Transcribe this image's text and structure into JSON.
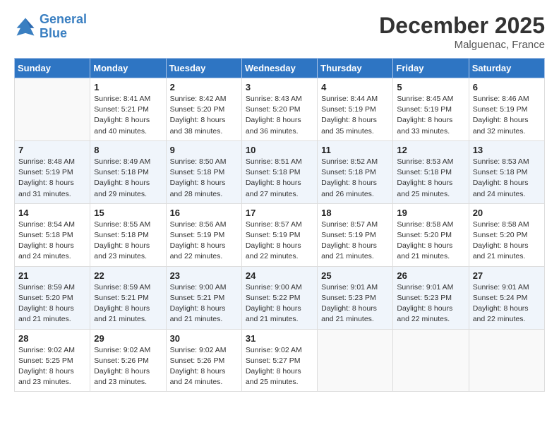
{
  "logo": {
    "line1": "General",
    "line2": "Blue"
  },
  "title": "December 2025",
  "location": "Malguenac, France",
  "days_header": [
    "Sunday",
    "Monday",
    "Tuesday",
    "Wednesday",
    "Thursday",
    "Friday",
    "Saturday"
  ],
  "weeks": [
    [
      {
        "num": "",
        "info": ""
      },
      {
        "num": "1",
        "info": "Sunrise: 8:41 AM\nSunset: 5:21 PM\nDaylight: 8 hours\nand 40 minutes."
      },
      {
        "num": "2",
        "info": "Sunrise: 8:42 AM\nSunset: 5:20 PM\nDaylight: 8 hours\nand 38 minutes."
      },
      {
        "num": "3",
        "info": "Sunrise: 8:43 AM\nSunset: 5:20 PM\nDaylight: 8 hours\nand 36 minutes."
      },
      {
        "num": "4",
        "info": "Sunrise: 8:44 AM\nSunset: 5:19 PM\nDaylight: 8 hours\nand 35 minutes."
      },
      {
        "num": "5",
        "info": "Sunrise: 8:45 AM\nSunset: 5:19 PM\nDaylight: 8 hours\nand 33 minutes."
      },
      {
        "num": "6",
        "info": "Sunrise: 8:46 AM\nSunset: 5:19 PM\nDaylight: 8 hours\nand 32 minutes."
      }
    ],
    [
      {
        "num": "7",
        "info": "Sunrise: 8:48 AM\nSunset: 5:19 PM\nDaylight: 8 hours\nand 31 minutes."
      },
      {
        "num": "8",
        "info": "Sunrise: 8:49 AM\nSunset: 5:18 PM\nDaylight: 8 hours\nand 29 minutes."
      },
      {
        "num": "9",
        "info": "Sunrise: 8:50 AM\nSunset: 5:18 PM\nDaylight: 8 hours\nand 28 minutes."
      },
      {
        "num": "10",
        "info": "Sunrise: 8:51 AM\nSunset: 5:18 PM\nDaylight: 8 hours\nand 27 minutes."
      },
      {
        "num": "11",
        "info": "Sunrise: 8:52 AM\nSunset: 5:18 PM\nDaylight: 8 hours\nand 26 minutes."
      },
      {
        "num": "12",
        "info": "Sunrise: 8:53 AM\nSunset: 5:18 PM\nDaylight: 8 hours\nand 25 minutes."
      },
      {
        "num": "13",
        "info": "Sunrise: 8:53 AM\nSunset: 5:18 PM\nDaylight: 8 hours\nand 24 minutes."
      }
    ],
    [
      {
        "num": "14",
        "info": "Sunrise: 8:54 AM\nSunset: 5:18 PM\nDaylight: 8 hours\nand 24 minutes."
      },
      {
        "num": "15",
        "info": "Sunrise: 8:55 AM\nSunset: 5:18 PM\nDaylight: 8 hours\nand 23 minutes."
      },
      {
        "num": "16",
        "info": "Sunrise: 8:56 AM\nSunset: 5:19 PM\nDaylight: 8 hours\nand 22 minutes."
      },
      {
        "num": "17",
        "info": "Sunrise: 8:57 AM\nSunset: 5:19 PM\nDaylight: 8 hours\nand 22 minutes."
      },
      {
        "num": "18",
        "info": "Sunrise: 8:57 AM\nSunset: 5:19 PM\nDaylight: 8 hours\nand 21 minutes."
      },
      {
        "num": "19",
        "info": "Sunrise: 8:58 AM\nSunset: 5:20 PM\nDaylight: 8 hours\nand 21 minutes."
      },
      {
        "num": "20",
        "info": "Sunrise: 8:58 AM\nSunset: 5:20 PM\nDaylight: 8 hours\nand 21 minutes."
      }
    ],
    [
      {
        "num": "21",
        "info": "Sunrise: 8:59 AM\nSunset: 5:20 PM\nDaylight: 8 hours\nand 21 minutes."
      },
      {
        "num": "22",
        "info": "Sunrise: 8:59 AM\nSunset: 5:21 PM\nDaylight: 8 hours\nand 21 minutes."
      },
      {
        "num": "23",
        "info": "Sunrise: 9:00 AM\nSunset: 5:21 PM\nDaylight: 8 hours\nand 21 minutes."
      },
      {
        "num": "24",
        "info": "Sunrise: 9:00 AM\nSunset: 5:22 PM\nDaylight: 8 hours\nand 21 minutes."
      },
      {
        "num": "25",
        "info": "Sunrise: 9:01 AM\nSunset: 5:23 PM\nDaylight: 8 hours\nand 21 minutes."
      },
      {
        "num": "26",
        "info": "Sunrise: 9:01 AM\nSunset: 5:23 PM\nDaylight: 8 hours\nand 22 minutes."
      },
      {
        "num": "27",
        "info": "Sunrise: 9:01 AM\nSunset: 5:24 PM\nDaylight: 8 hours\nand 22 minutes."
      }
    ],
    [
      {
        "num": "28",
        "info": "Sunrise: 9:02 AM\nSunset: 5:25 PM\nDaylight: 8 hours\nand 23 minutes."
      },
      {
        "num": "29",
        "info": "Sunrise: 9:02 AM\nSunset: 5:26 PM\nDaylight: 8 hours\nand 23 minutes."
      },
      {
        "num": "30",
        "info": "Sunrise: 9:02 AM\nSunset: 5:26 PM\nDaylight: 8 hours\nand 24 minutes."
      },
      {
        "num": "31",
        "info": "Sunrise: 9:02 AM\nSunset: 5:27 PM\nDaylight: 8 hours\nand 25 minutes."
      },
      {
        "num": "",
        "info": ""
      },
      {
        "num": "",
        "info": ""
      },
      {
        "num": "",
        "info": ""
      }
    ]
  ]
}
